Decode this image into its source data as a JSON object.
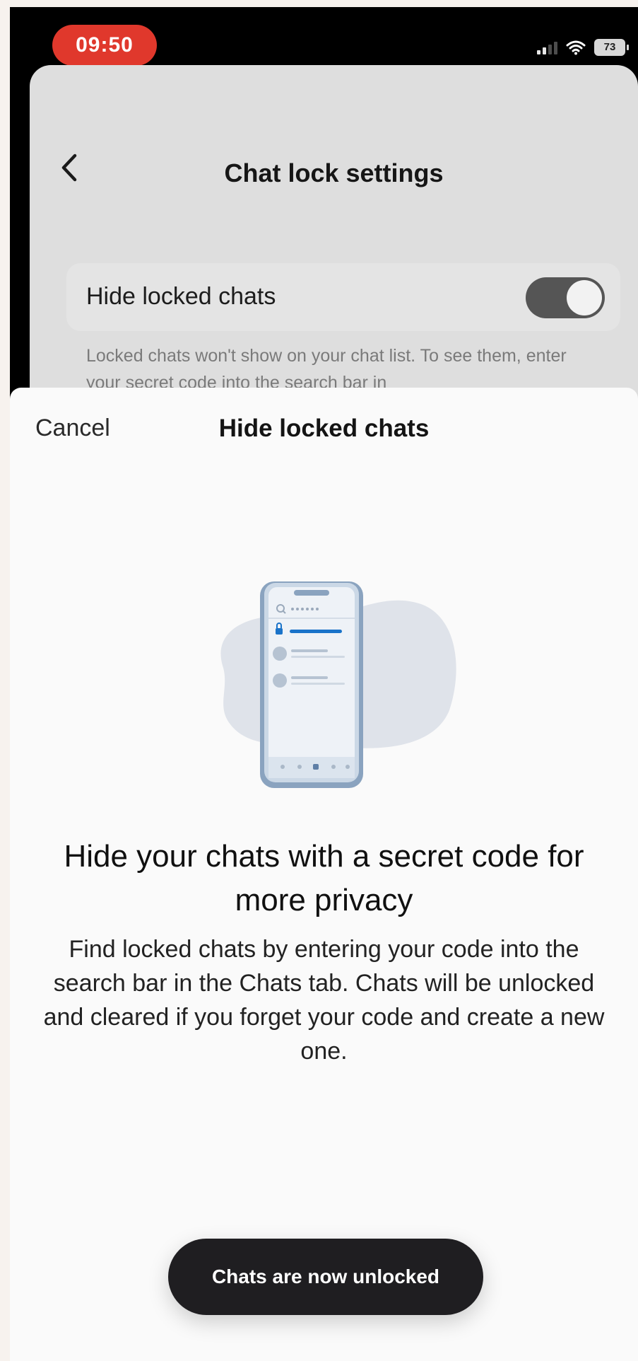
{
  "status_bar": {
    "time": "09:50",
    "battery": "73"
  },
  "settings_screen": {
    "title": "Chat lock settings",
    "toggle_label": "Hide locked chats",
    "toggle_on": true,
    "description": "Locked chats won't show on your chat list. To see them, enter your secret code into the search bar in"
  },
  "sheet": {
    "cancel_label": "Cancel",
    "title": "Hide locked chats",
    "headline": "Hide your chats with a secret code for more privacy",
    "body": "Find locked chats by entering your code into the search bar in the Chats tab. Chats will be unlocked and cleared if you forget your code and create a new one."
  },
  "toast": {
    "message": "Chats are now unlocked"
  },
  "icons": [
    "back-chevron-icon",
    "signal-icon",
    "wifi-icon",
    "battery-icon",
    "phone-illustration",
    "lock-icon",
    "search-icon"
  ],
  "colors": {
    "time_pill": "#e0382c",
    "toggle_track": "#555555",
    "illustration_accent": "#1a73c9",
    "toast_bg": "#1f1e21"
  }
}
